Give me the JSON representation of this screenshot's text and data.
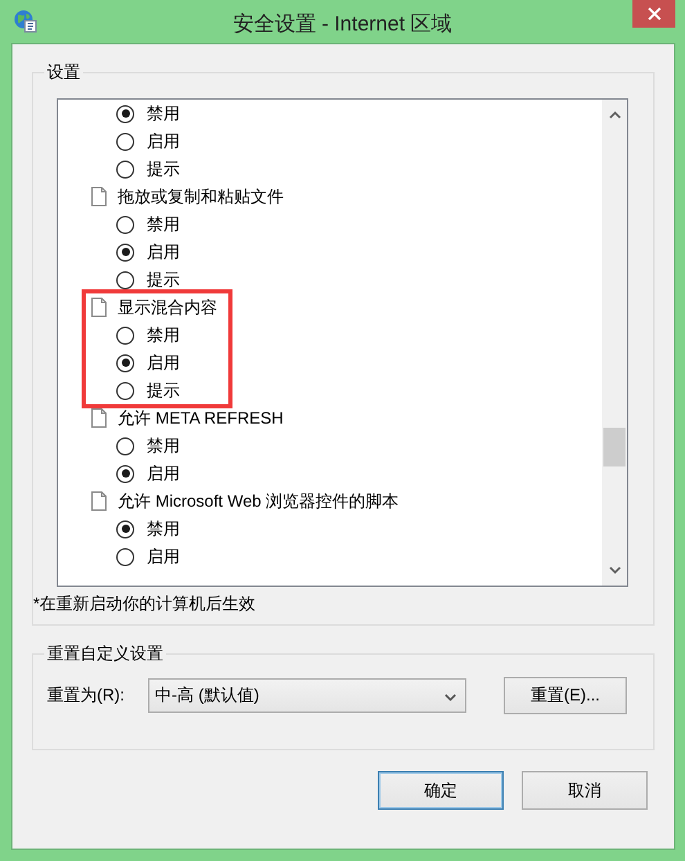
{
  "window": {
    "title": "安全设置 - Internet 区域"
  },
  "settings": {
    "label": "设置",
    "groups": [
      {
        "options": [
          {
            "label": "禁用",
            "selected": true
          },
          {
            "label": "启用",
            "selected": false
          },
          {
            "label": "提示",
            "selected": false
          }
        ]
      },
      {
        "title": "拖放或复制和粘贴文件",
        "options": [
          {
            "label": "禁用",
            "selected": false
          },
          {
            "label": "启用",
            "selected": true
          },
          {
            "label": "提示",
            "selected": false
          }
        ]
      },
      {
        "title": "显示混合内容",
        "highlighted": true,
        "options": [
          {
            "label": "禁用",
            "selected": false
          },
          {
            "label": "启用",
            "selected": true
          },
          {
            "label": "提示",
            "selected": false
          }
        ]
      },
      {
        "title": "允许 META REFRESH",
        "options": [
          {
            "label": "禁用",
            "selected": false
          },
          {
            "label": "启用",
            "selected": true
          }
        ]
      },
      {
        "title": "允许 Microsoft Web 浏览器控件的脚本",
        "options": [
          {
            "label": "禁用",
            "selected": true
          },
          {
            "label": "启用",
            "selected": false
          }
        ]
      }
    ],
    "note": "*在重新启动你的计算机后生效"
  },
  "reset": {
    "label": "重置自定义设置",
    "field_label": "重置为(R):",
    "value": "中-高 (默认值)",
    "button": "重置(E)..."
  },
  "buttons": [
    {
      "label": "确定",
      "default": true
    },
    {
      "label": "取消",
      "default": false
    }
  ]
}
